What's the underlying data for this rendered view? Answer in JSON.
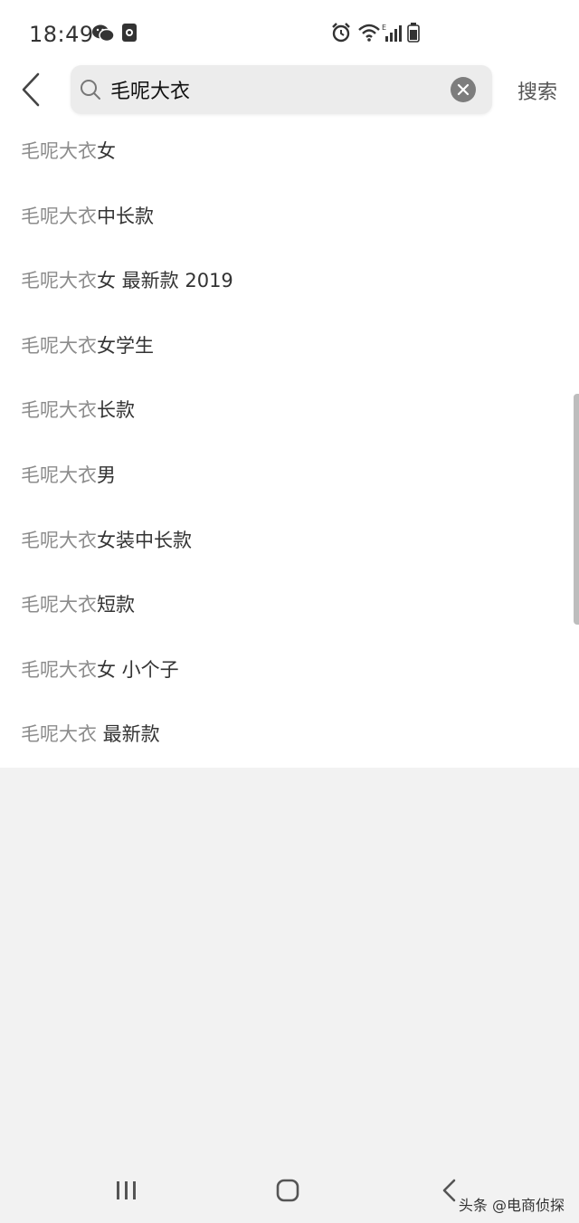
{
  "status_bar": {
    "time": "18:49",
    "icons": [
      "wechat-icon",
      "notification-icon",
      "alarm-icon",
      "wifi-icon",
      "signal-icon",
      "battery-icon"
    ]
  },
  "search": {
    "value": "毛呢大衣",
    "placeholder": "",
    "button_label": "搜索"
  },
  "suggestions": [
    {
      "prefix": "毛呢大衣",
      "suffix": "女"
    },
    {
      "prefix": "毛呢大衣",
      "suffix": "中长款"
    },
    {
      "prefix": "毛呢大衣",
      "suffix": "女 最新款 2019"
    },
    {
      "prefix": "毛呢大衣",
      "suffix": "女学生"
    },
    {
      "prefix": "毛呢大衣",
      "suffix": "长款"
    },
    {
      "prefix": "毛呢大衣",
      "suffix": "男"
    },
    {
      "prefix": "毛呢大衣",
      "suffix": "女装中长款"
    },
    {
      "prefix": "毛呢大衣",
      "suffix": "短款"
    },
    {
      "prefix": "毛呢大衣",
      "suffix": "女 小个子"
    },
    {
      "prefix": "毛呢大衣",
      "suffix": " 最新款"
    }
  ],
  "watermark": "头条 @电商侦探",
  "colors": {
    "background": "#f2f2f2",
    "panel": "#ffffff",
    "prefix_text": "#8c8c8c",
    "suffix_text": "#333333"
  }
}
